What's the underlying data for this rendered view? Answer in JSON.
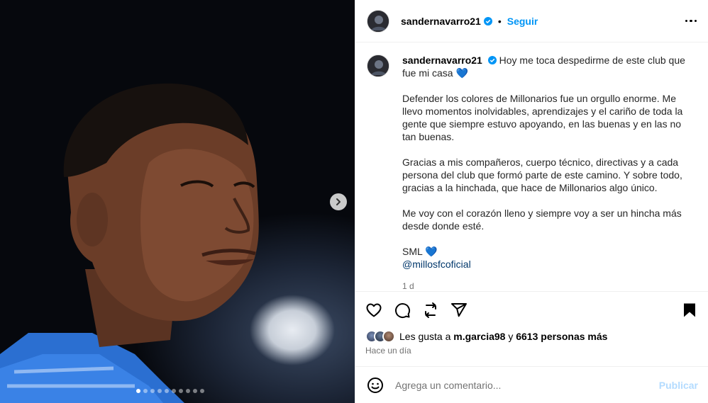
{
  "post": {
    "username": "sandernavarro21",
    "follow_label": "Seguir",
    "separator": "•"
  },
  "caption": {
    "username": "sandernavarro21",
    "first_line": "Hoy me toca despedirme de este club que fue mi casa",
    "heart": "💙",
    "paragraph_2": "Defender los colores de Millonarios fue un orgullo enorme. Me llevo momentos inolvidables, aprendizajes y el cariño de toda la gente que siempre estuvo apoyando, en las buenas y en las no tan buenas.",
    "paragraph_3": "Gracias a mis compañeros, cuerpo técnico, directivas y a cada persona del club que formó parte de este camino. Y sobre todo, gracias a la hinchada, que hace de Millonarios algo único.",
    "paragraph_4": "Me voy con el corazón lleno y siempre voy a ser un hincha más desde donde esté.",
    "signature": "SML",
    "signature_heart": "💙",
    "mention": "@millosfcoficial",
    "time": "1 d"
  },
  "likes": {
    "prefix": "Les gusta a",
    "user": "m.garcia98",
    "joiner": "y",
    "others": "6613 personas más"
  },
  "posted_ago": "Hace un día",
  "comment": {
    "placeholder": "Agrega un comentario...",
    "publish_label": "Publicar"
  },
  "carousel": {
    "total_slides": 10,
    "active_slide": 1
  },
  "icons": [
    "heart-icon",
    "comment-icon",
    "repost-icon",
    "share-icon",
    "bookmark-icon",
    "emoji-icon",
    "more-icon",
    "chevron-right-icon",
    "verified-badge-icon"
  ],
  "colors": {
    "accent": "#0095f6",
    "publish_disabled": "#b3dbff",
    "verified": "#0095f6",
    "muted": "#737373"
  }
}
